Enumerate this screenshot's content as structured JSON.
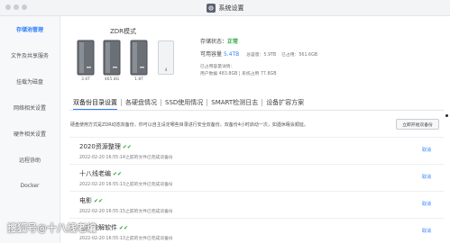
{
  "window": {
    "title": "系统设置",
    "title_icon": "gear-icon"
  },
  "sidebar": {
    "items": [
      {
        "label": "存储池管理",
        "active": true
      },
      {
        "label": "文件及共享服务",
        "active": false
      },
      {
        "label": "挂载为磁盘",
        "active": false
      },
      {
        "label": "网络相关设置",
        "active": false
      },
      {
        "label": "硬件相关设置",
        "active": false
      },
      {
        "label": "远程协助",
        "active": false
      },
      {
        "label": "Docker",
        "active": false
      }
    ]
  },
  "zdr": {
    "title": "ZDR模式",
    "disks": [
      {
        "label": "3.6T",
        "icon": "hard-disk-icon"
      },
      {
        "label": "465.8G",
        "icon": "hard-disk-icon"
      },
      {
        "label": "1.8T",
        "icon": "hard-disk-icon"
      },
      {
        "label": "4",
        "icon": "empty-disk-slot-icon"
      }
    ]
  },
  "status": {
    "state_label": "存储状态：",
    "state_value": "正常",
    "capacity_label": "可用容量",
    "capacity_value": "5.4TB",
    "total_text": "总容量：5.9TB",
    "used_text": "已占用：561.6GB",
    "detail_label": "已占用容量详情：",
    "detail_text": "用户数据 483.8GB | 系统占用 77.8GB"
  },
  "tabs": [
    {
      "label": "双备份目录设置",
      "active": true
    },
    {
      "label": "各硬盘情况",
      "active": false
    },
    {
      "label": "SSD使用情况",
      "active": false
    },
    {
      "label": "SMART检测日志",
      "active": false
    },
    {
      "label": "设备扩容方案",
      "active": false
    }
  ],
  "backup": {
    "description": "硬盘使用方式是ZDR动态双备份，你可以自主设定哪些目录进行安全双备份。双备份4小时启动一次，如遇休眠会顺延。",
    "button_label": "立即开始双备份",
    "cancel_label": "取消",
    "items": [
      {
        "name": "2020资源整理",
        "checks": "✔✔",
        "time": "2022-02-20 16:55:14之前的文件已完成双备份"
      },
      {
        "name": "十八线老编",
        "checks": "✔✔",
        "time": "2022-02-20 16:55:13之前的文件已完成双备份"
      },
      {
        "name": "电影",
        "checks": "✔✔",
        "time": "2022-02-20 16:55:15之前的文件已完成双备份"
      },
      {
        "name": "经典破解软件",
        "checks": "✔✔",
        "time": "2022-02-20 16:55:13之前的文件已完成双备份"
      }
    ]
  },
  "watermark": "搜狐号@十八线老编"
}
